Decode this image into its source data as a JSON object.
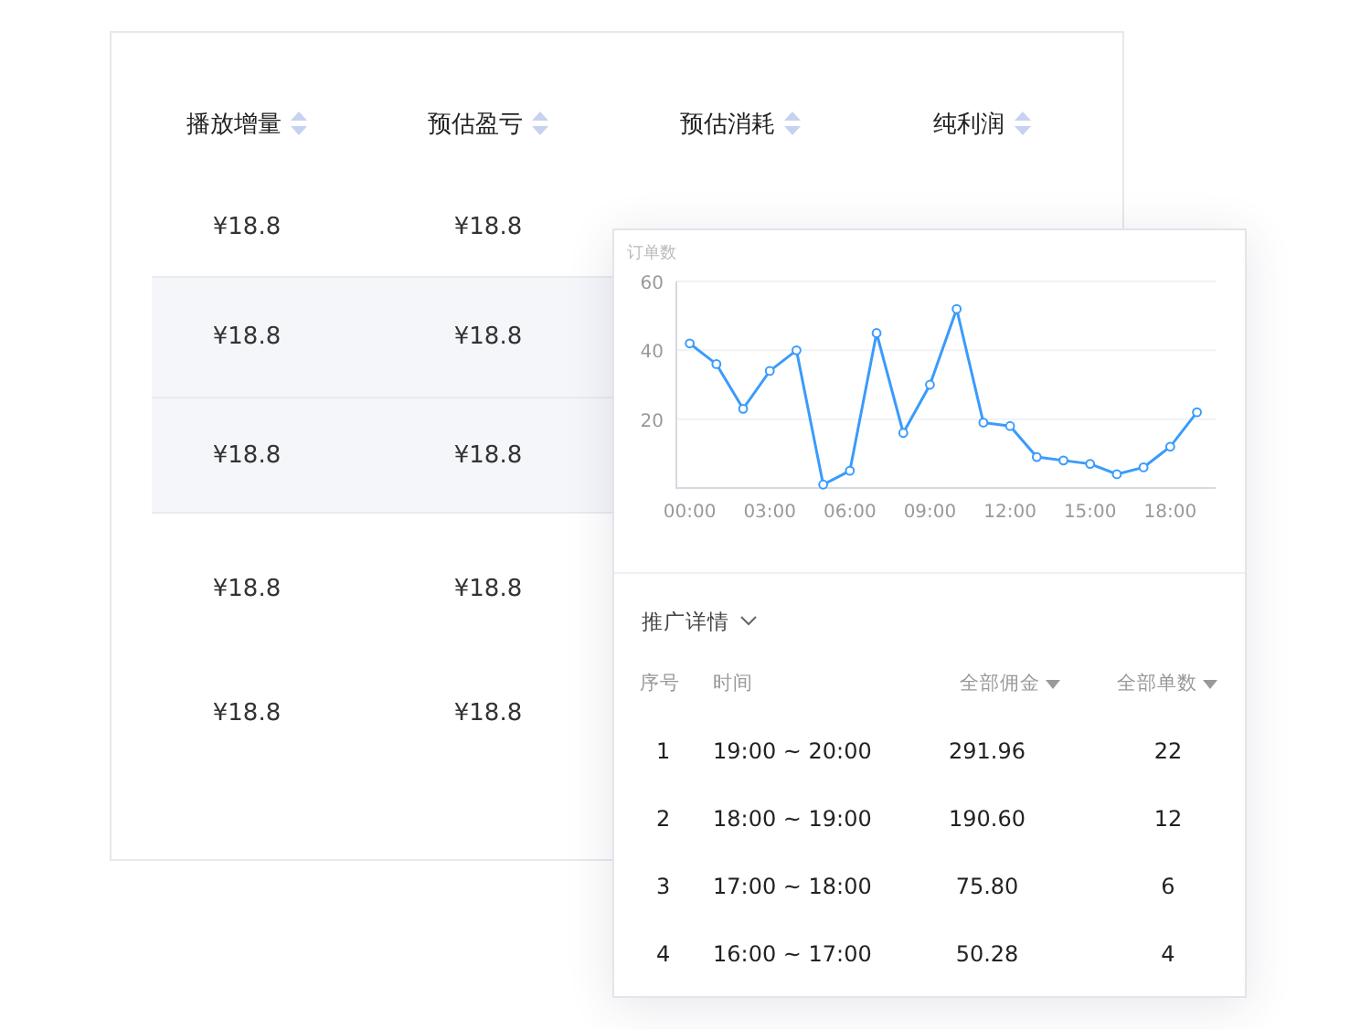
{
  "main_table": {
    "columns": [
      {
        "label": "播放增量"
      },
      {
        "label": "预估盈亏"
      },
      {
        "label": "预估消耗"
      },
      {
        "label": "纯利润"
      }
    ],
    "rows": [
      {
        "highlighted": false,
        "cells": [
          "¥18.8",
          "¥18.8"
        ]
      },
      {
        "highlighted": true,
        "cells": [
          "¥18.8",
          "¥18.8"
        ]
      },
      {
        "highlighted": true,
        "cells": [
          "¥18.8",
          "¥18.8"
        ]
      },
      {
        "highlighted": false,
        "cells": [
          "¥18.8",
          "¥18.8"
        ]
      },
      {
        "highlighted": false,
        "cells": [
          "¥18.8",
          "¥18.8"
        ]
      }
    ]
  },
  "popup": {
    "chart": {
      "chart_data": {
        "type": "line",
        "x": [
          0,
          1,
          2,
          3,
          4,
          5,
          6,
          7,
          8,
          9,
          10,
          11,
          12,
          13,
          14,
          15,
          16,
          17,
          18,
          19
        ],
        "xticks": [
          {
            "value": 0,
            "label": "00:00"
          },
          {
            "value": 3,
            "label": "03:00"
          },
          {
            "value": 6,
            "label": "06:00"
          },
          {
            "value": 9,
            "label": "09:00"
          },
          {
            "value": 12,
            "label": "12:00"
          },
          {
            "value": 15,
            "label": "15:00"
          },
          {
            "value": 18,
            "label": "18:00"
          }
        ],
        "xlim": [
          -0.5,
          19.7
        ],
        "ylim": [
          0,
          60
        ],
        "yticks": [
          20,
          40,
          60
        ],
        "series": [
          {
            "name": "订单数",
            "color": "#3a9bfc",
            "marker": "circle",
            "values": [
              42,
              36,
              23,
              34,
              40,
              1,
              5,
              45,
              16,
              30,
              52,
              19,
              18,
              9,
              8,
              7,
              4,
              6,
              12,
              22
            ]
          }
        ]
      }
    },
    "section_title": "推广详情",
    "columns": [
      {
        "label": "序号",
        "sortable": false
      },
      {
        "label": "时间",
        "sortable": false
      },
      {
        "label": "全部佣金",
        "sortable": true
      },
      {
        "label": "全部单数",
        "sortable": true
      }
    ],
    "rows": [
      {
        "index": "1",
        "time": "19:00 ~ 20:00",
        "commission": "291.96",
        "orders": "22"
      },
      {
        "index": "2",
        "time": "18:00 ~ 19:00",
        "commission": "190.60",
        "orders": "12"
      },
      {
        "index": "3",
        "time": "17:00 ~ 18:00",
        "commission": "75.80",
        "orders": "6"
      },
      {
        "index": "4",
        "time": "16:00 ~ 17:00",
        "commission": "50.28",
        "orders": "4"
      }
    ]
  }
}
